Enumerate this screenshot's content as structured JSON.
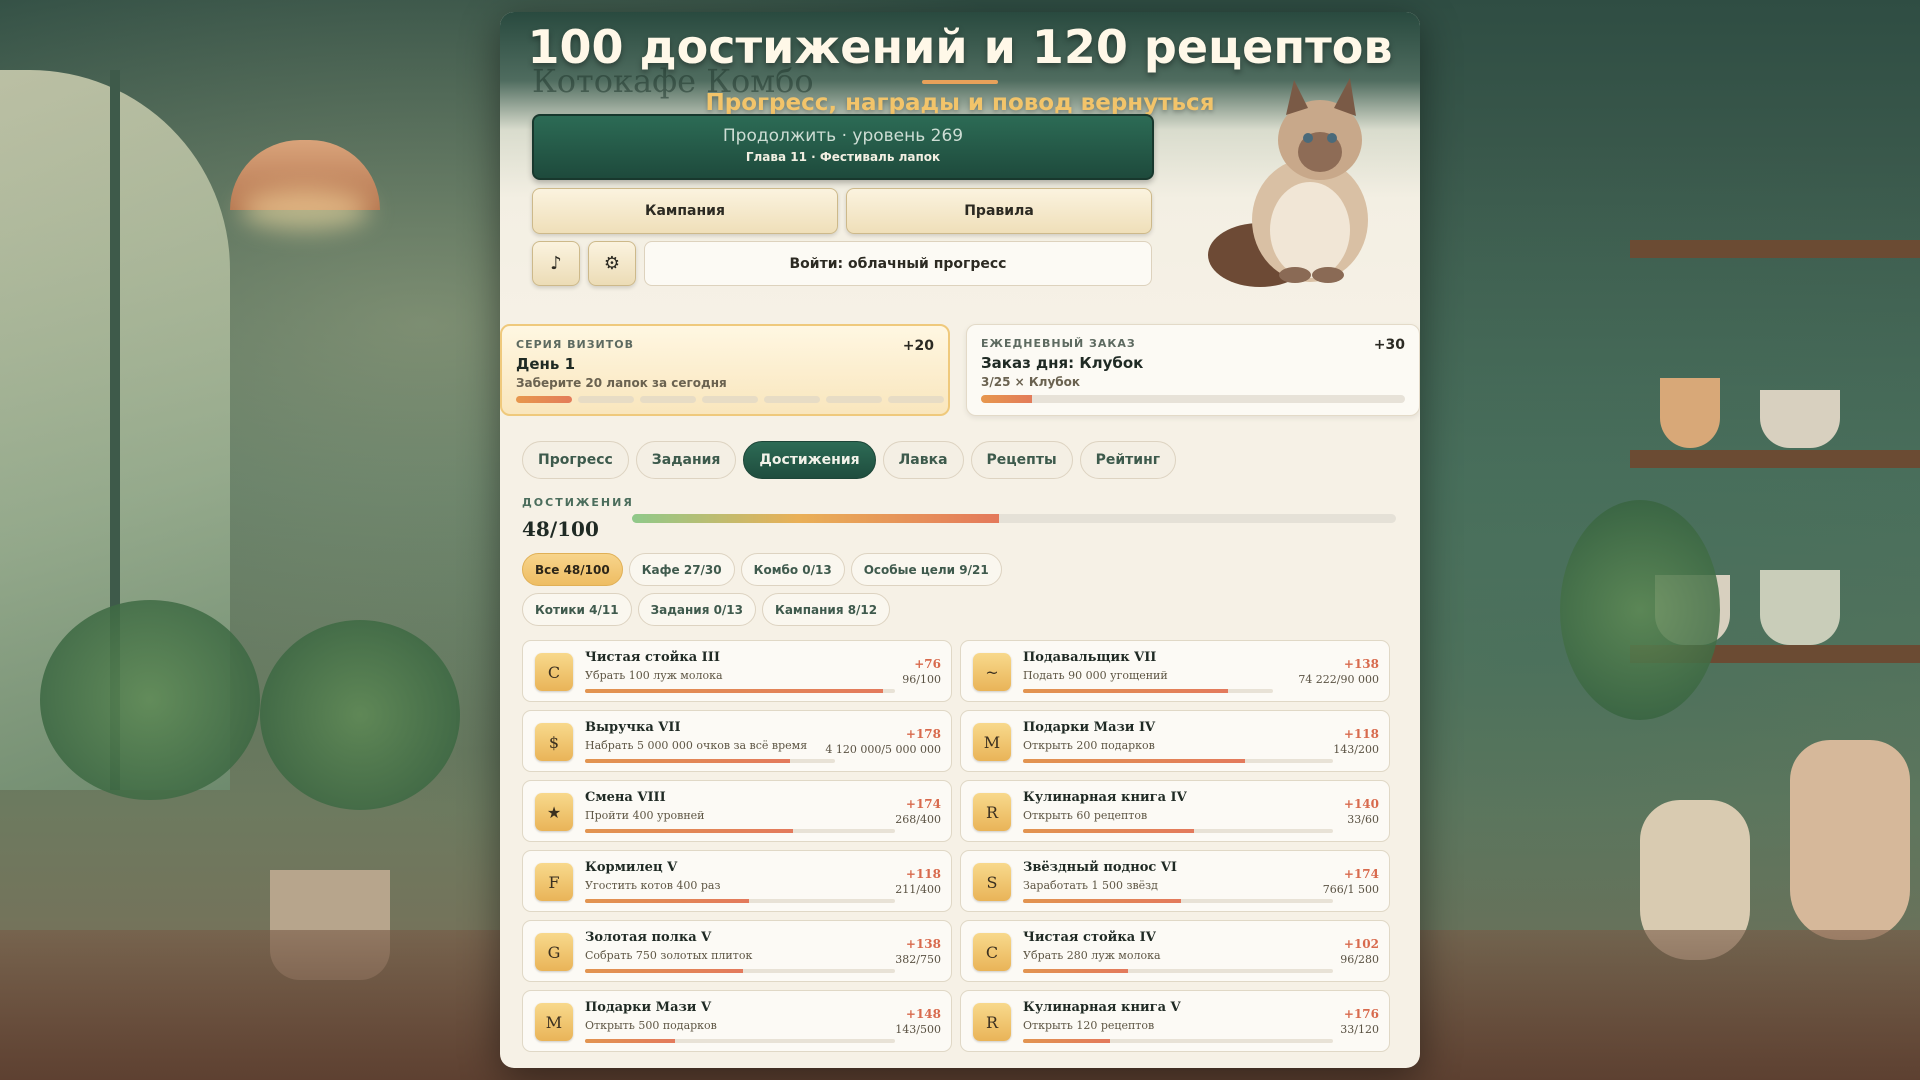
{
  "hero": {
    "title": "100 достижений и 120 рецептов",
    "subtitle": "Прогресс, награды и повод вернуться",
    "logo_text": "Котокафе Комбо"
  },
  "menu": {
    "continue_label": "Продолжить · уровень 269",
    "continue_sub": "Глава 11 · Фестиваль лапок",
    "campaign_label": "Кампания",
    "rules_label": "Правила",
    "music_icon": "♪",
    "settings_icon": "⚙",
    "login_label": "Войти: облачный прогресс"
  },
  "streak": {
    "label": "СЕРИЯ ВИЗИТОВ",
    "title": "День 1",
    "desc": "Заберите 20 лапок за сегодня",
    "reward": "+20",
    "days_filled": 1,
    "days_total": 7
  },
  "daily": {
    "label": "ЕЖЕДНЕВНЫЙ ЗАКАЗ",
    "title": "Заказ дня: Клубок",
    "desc": "3/25 × Клубок",
    "reward": "+30",
    "progress": 0.12
  },
  "tabs": [
    "Прогресс",
    "Задания",
    "Достижения",
    "Лавка",
    "Рецепты",
    "Рейтинг"
  ],
  "active_tab": "Достижения",
  "achievements": {
    "section_label": "ДОСТИЖЕНИЯ",
    "count": "48/100",
    "progress": 0.48,
    "filters": [
      {
        "label": "Все 48/100",
        "active": true
      },
      {
        "label": "Кафе 27/30",
        "active": false
      },
      {
        "label": "Комбо 0/13",
        "active": false
      },
      {
        "label": "Особые цели 9/21",
        "active": false
      },
      {
        "label": "Котики 4/11",
        "active": false
      },
      {
        "label": "Задания 0/13",
        "active": false
      },
      {
        "label": "Кампания 8/12",
        "active": false
      }
    ],
    "items": [
      {
        "icon": "C",
        "title": "Чистая стойка III",
        "desc": "Убрать 100 луж молока",
        "reward": "+76",
        "progress": "96/100",
        "fraction": 0.96
      },
      {
        "icon": "~",
        "title": "Подавальщик VII",
        "desc": "Подать 90 000 угощений",
        "reward": "+138",
        "progress": "74 222/90 000",
        "fraction": 0.82
      },
      {
        "icon": "$",
        "title": "Выручка VII",
        "desc": "Набрать 5 000 000 очков за всё время",
        "reward": "+178",
        "progress": "4 120 000/5 000 000",
        "fraction": 0.82
      },
      {
        "icon": "M",
        "title": "Подарки Мази IV",
        "desc": "Открыть 200 подарков",
        "reward": "+118",
        "progress": "143/200",
        "fraction": 0.715
      },
      {
        "icon": "★",
        "title": "Смена VIII",
        "desc": "Пройти 400 уровней",
        "reward": "+174",
        "progress": "268/400",
        "fraction": 0.67
      },
      {
        "icon": "R",
        "title": "Кулинарная книга IV",
        "desc": "Открыть 60 рецептов",
        "reward": "+140",
        "progress": "33/60",
        "fraction": 0.55
      },
      {
        "icon": "F",
        "title": "Кормилец V",
        "desc": "Угостить котов 400 раз",
        "reward": "+118",
        "progress": "211/400",
        "fraction": 0.53
      },
      {
        "icon": "S",
        "title": "Звёздный поднос VI",
        "desc": "Заработать 1 500 звёзд",
        "reward": "+174",
        "progress": "766/1 500",
        "fraction": 0.51
      },
      {
        "icon": "G",
        "title": "Золотая полка V",
        "desc": "Собрать 750 золотых плиток",
        "reward": "+138",
        "progress": "382/750",
        "fraction": 0.51
      },
      {
        "icon": "C",
        "title": "Чистая стойка IV",
        "desc": "Убрать 280 луж молока",
        "reward": "+102",
        "progress": "96/280",
        "fraction": 0.34
      },
      {
        "icon": "M",
        "title": "Подарки Мази V",
        "desc": "Открыть 500 подарков",
        "reward": "+148",
        "progress": "143/500",
        "fraction": 0.29
      },
      {
        "icon": "R",
        "title": "Кулинарная книга V",
        "desc": "Открыть 120 рецептов",
        "reward": "+176",
        "progress": "33/120",
        "fraction": 0.28
      }
    ]
  },
  "colors": {
    "accent_green": "#1f4d3e",
    "accent_gold": "#eebd63",
    "reward_red": "#d86a4d"
  }
}
